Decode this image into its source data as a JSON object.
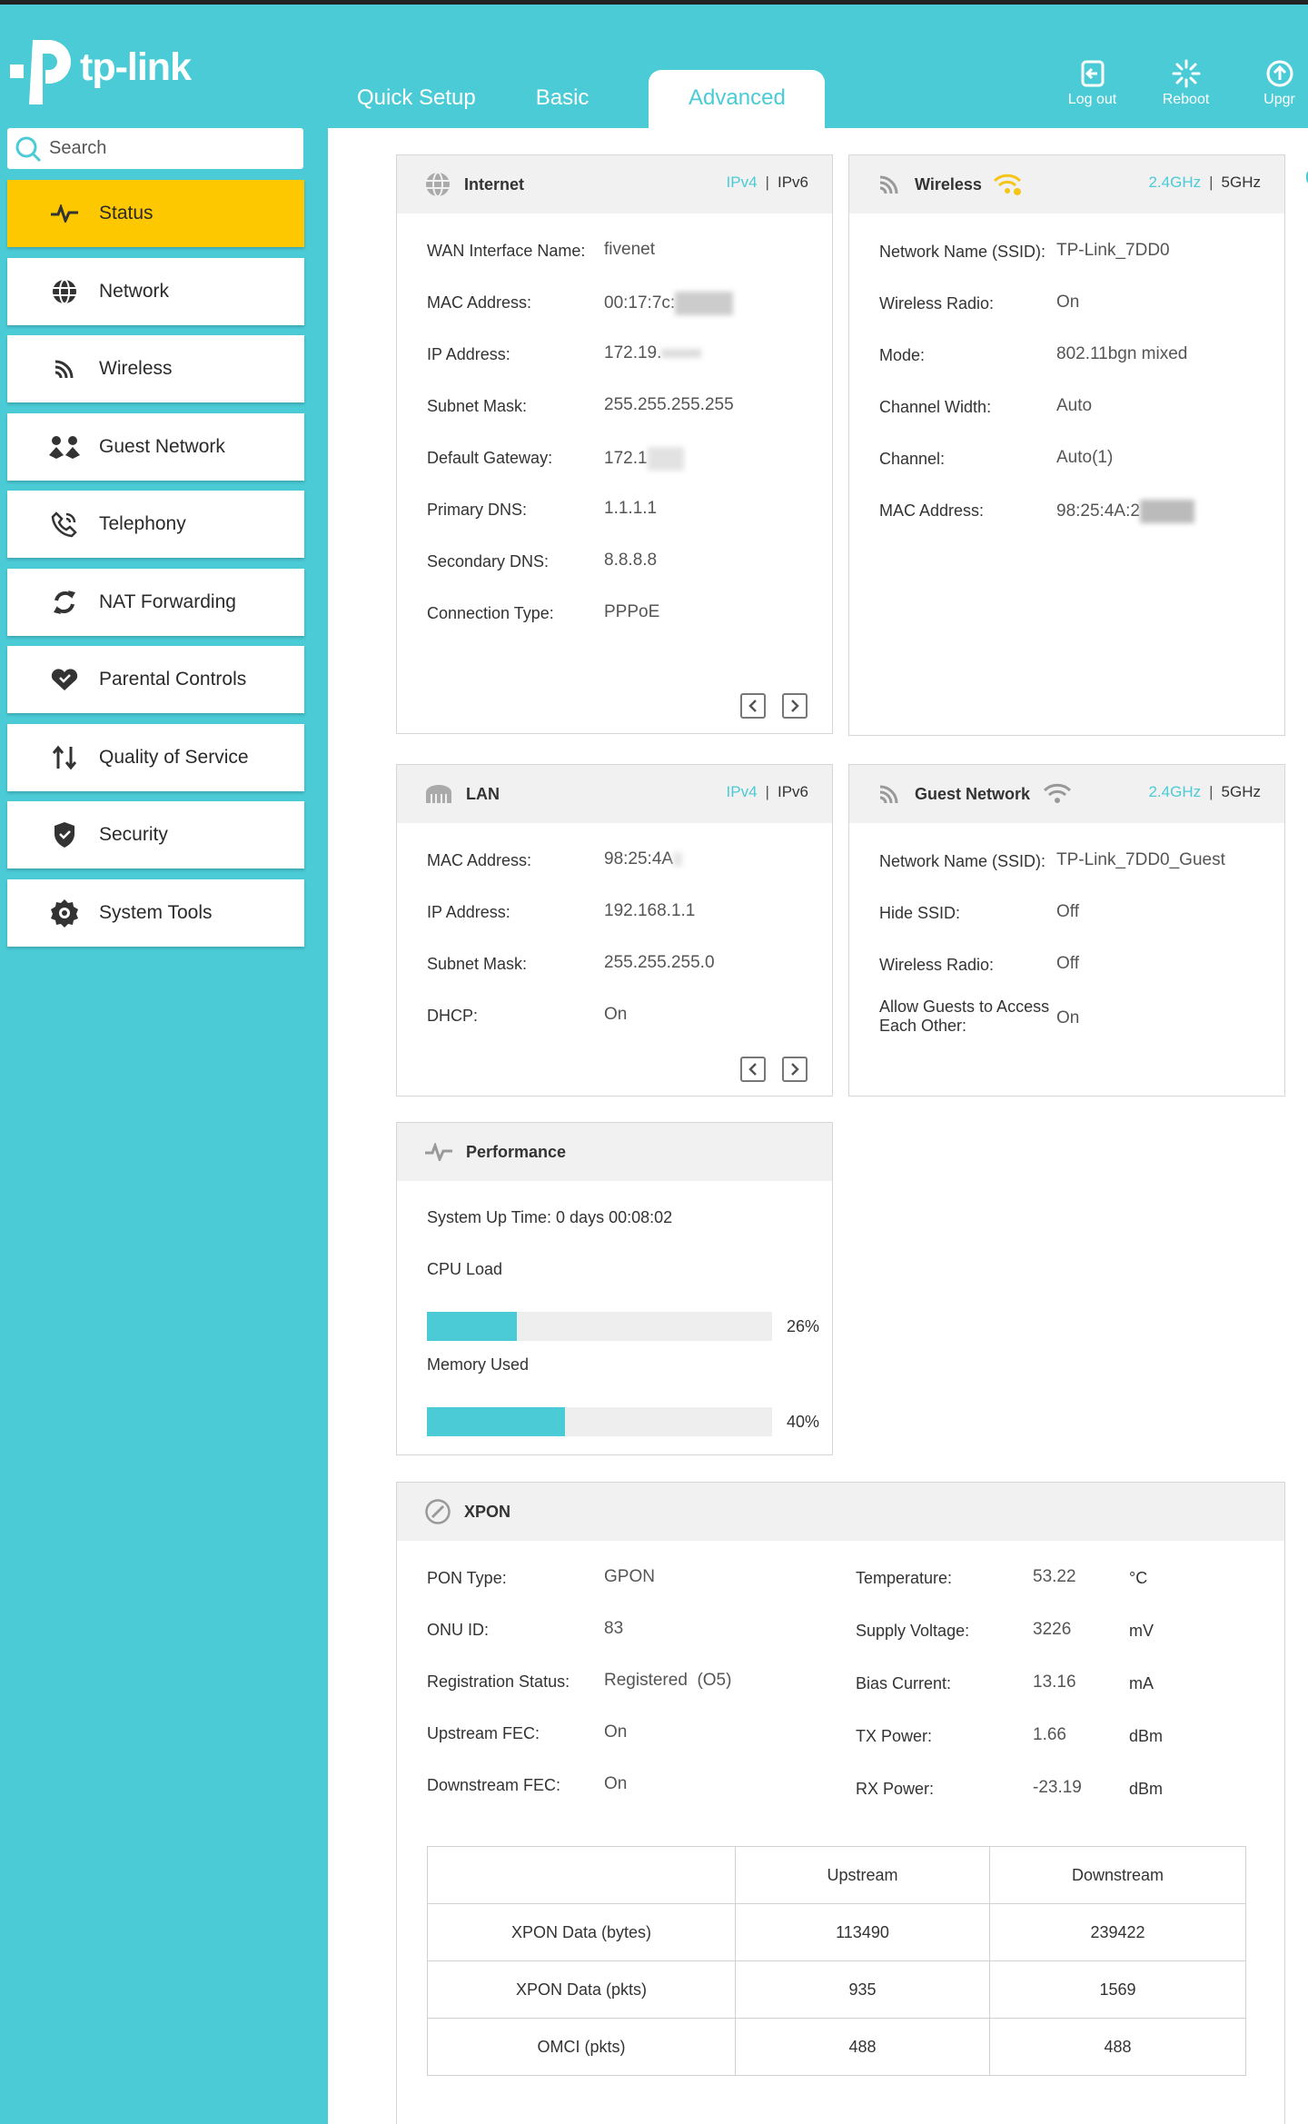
{
  "brand": {
    "name": "tp-link"
  },
  "tabs": [
    {
      "label": "Quick Setup"
    },
    {
      "label": "Basic"
    },
    {
      "label": "Advanced",
      "active": true
    }
  ],
  "header_actions": [
    {
      "label": "Log out",
      "icon": "logout-icon"
    },
    {
      "label": "Reboot",
      "icon": "reboot-icon"
    },
    {
      "label": "Upgr",
      "icon": "upgrade-icon"
    }
  ],
  "search": {
    "placeholder": "Search"
  },
  "sidebar": {
    "items": [
      {
        "label": "Status",
        "icon": "pulse-icon",
        "active": true
      },
      {
        "label": "Network",
        "icon": "globe-icon"
      },
      {
        "label": "Wireless",
        "icon": "wifi-icon"
      },
      {
        "label": "Guest Network",
        "icon": "guest-icon"
      },
      {
        "label": "Telephony",
        "icon": "phone-icon"
      },
      {
        "label": "NAT Forwarding",
        "icon": "nat-icon"
      },
      {
        "label": "Parental Controls",
        "icon": "heart-icon"
      },
      {
        "label": "Quality of Service",
        "icon": "qos-icon"
      },
      {
        "label": "Security",
        "icon": "shield-icon"
      },
      {
        "label": "System Tools",
        "icon": "gear-icon"
      }
    ]
  },
  "internet": {
    "title": "Internet",
    "bands": {
      "a": "IPv4",
      "b": "IPv6",
      "selected": "IPv4"
    },
    "rows": [
      {
        "k": "WAN Interface Name:",
        "v": "fivenet"
      },
      {
        "k": "MAC Address:",
        "v": "00:17:7c:"
      },
      {
        "k": "IP Address:",
        "v": "172.19."
      },
      {
        "k": "Subnet Mask:",
        "v": "255.255.255.255"
      },
      {
        "k": "Default Gateway:",
        "v": "172.1"
      },
      {
        "k": "Primary DNS:",
        "v": "1.1.1.1"
      },
      {
        "k": "Secondary DNS:",
        "v": "8.8.8.8"
      },
      {
        "k": "Connection Type:",
        "v": "PPPoE"
      }
    ]
  },
  "wireless": {
    "title": "Wireless",
    "bands": {
      "a": "2.4GHz",
      "b": "5GHz",
      "selected": "2.4GHz"
    },
    "rows": [
      {
        "k": "Network Name (SSID):",
        "v": "TP-Link_7DD0"
      },
      {
        "k": "Wireless Radio:",
        "v": "On"
      },
      {
        "k": "Mode:",
        "v": "802.11bgn mixed"
      },
      {
        "k": "Channel Width:",
        "v": "Auto"
      },
      {
        "k": "Channel:",
        "v": "Auto(1)"
      },
      {
        "k": "MAC Address:",
        "v": "98:25:4A:2"
      }
    ]
  },
  "lan": {
    "title": "LAN",
    "bands": {
      "a": "IPv4",
      "b": "IPv6",
      "selected": "IPv4"
    },
    "rows": [
      {
        "k": "MAC Address:",
        "v": "98:25:4A"
      },
      {
        "k": "IP Address:",
        "v": "192.168.1.1"
      },
      {
        "k": "Subnet Mask:",
        "v": "255.255.255.0"
      },
      {
        "k": "DHCP:",
        "v": "On"
      }
    ]
  },
  "guest": {
    "title": "Guest Network",
    "bands": {
      "a": "2.4GHz",
      "b": "5GHz",
      "selected": "2.4GHz"
    },
    "rows": [
      {
        "k": "Network Name (SSID):",
        "v": "TP-Link_7DD0_Guest"
      },
      {
        "k": "Hide SSID:",
        "v": "Off"
      },
      {
        "k": "Wireless Radio:",
        "v": "Off"
      },
      {
        "k": "Allow Guests to Access Each Other:",
        "v": "On"
      }
    ]
  },
  "performance": {
    "title": "Performance",
    "uptime": "System Up Time: 0 days 00:08:02",
    "cpu_label": "CPU Load",
    "cpu_pct": 26,
    "cpu_text": "26%",
    "mem_label": "Memory Used",
    "mem_pct": 40,
    "mem_text": "40%"
  },
  "xpon": {
    "title": "XPON",
    "left": [
      {
        "k": "PON Type:",
        "v": "GPON"
      },
      {
        "k": "ONU ID:",
        "v": "83"
      },
      {
        "k": "Registration Status:",
        "v": "Registered  (O5)"
      },
      {
        "k": "Upstream FEC:",
        "v": "On"
      },
      {
        "k": "Downstream FEC:",
        "v": "On"
      }
    ],
    "right": [
      {
        "k": "Temperature:",
        "v": "53.22",
        "u": "°C"
      },
      {
        "k": "Supply Voltage:",
        "v": "3226",
        "u": "mV"
      },
      {
        "k": "Bias Current:",
        "v": "13.16",
        "u": "mA"
      },
      {
        "k": "TX Power:",
        "v": "1.66",
        "u": "dBm"
      },
      {
        "k": "RX Power:",
        "v": "-23.19",
        "u": "dBm"
      }
    ],
    "table": {
      "headers": [
        "",
        "Upstream",
        "Downstream"
      ],
      "rows": [
        [
          "XPON Data (bytes)",
          "113490",
          "239422"
        ],
        [
          "XPON Data (pkts)",
          "935",
          "1569"
        ],
        [
          "OMCI (pkts)",
          "488",
          "488"
        ]
      ]
    }
  },
  "colors": {
    "accent": "#4acbd6",
    "active_nav": "#fdc800",
    "wifi_active": "#f5c518"
  }
}
